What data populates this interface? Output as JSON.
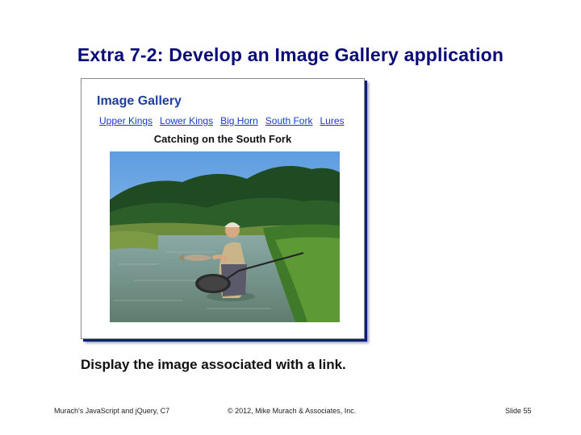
{
  "slide": {
    "title": "Extra 7-2: Develop an Image Gallery application",
    "subtitle": "Display the image associated with a link."
  },
  "gallery": {
    "heading": "Image Gallery",
    "links": [
      {
        "label": "Upper Kings"
      },
      {
        "label": "Lower Kings"
      },
      {
        "label": "Big Horn"
      },
      {
        "label": "South Fork"
      },
      {
        "label": "Lures"
      }
    ],
    "caption": "Catching on the South Fork"
  },
  "footer": {
    "left": "Murach's JavaScript and jQuery, C7",
    "center": "© 2012, Mike Murach & Associates, Inc.",
    "right": "Slide 55"
  },
  "colors": {
    "title": "#0a0a78",
    "heading": "#1e3fa0",
    "link": "#1a3cc0"
  }
}
